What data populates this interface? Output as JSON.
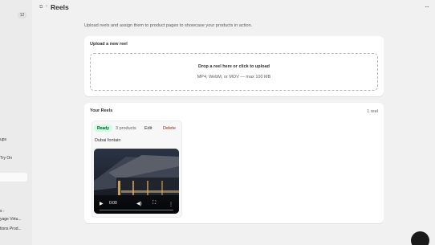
{
  "sidebar": {
    "badge": "12",
    "items": [
      "ups",
      "Try On",
      "s",
      "yage Virtu...",
      "tions Prod..."
    ]
  },
  "header": {
    "breadcrumb_icon": "app-icon",
    "title": "Reels",
    "more_icon": "more-horizontal-icon"
  },
  "subtitle": "Upload reels and assign them to product pages to showcase your products in action.",
  "upload": {
    "title": "Upload a new reel",
    "drop_title": "Drop a reel here or click to upload",
    "drop_hint": "MP4, WebM, or MOV — max 100 MB"
  },
  "reels": {
    "title": "Your Reels",
    "count": "1 reel",
    "items": [
      {
        "status": "Ready",
        "status_color": "#cdfee1",
        "products": "3 products",
        "edit_label": "Edit",
        "delete_label": "Delete",
        "name": "Dubai fontain",
        "video": {
          "time": "0:00",
          "progress": 0
        }
      }
    ]
  },
  "colors": {
    "background": "#f1f1f1",
    "card": "#ffffff",
    "ready_badge": "#cdfee1",
    "delete": "#8e1f0b"
  }
}
